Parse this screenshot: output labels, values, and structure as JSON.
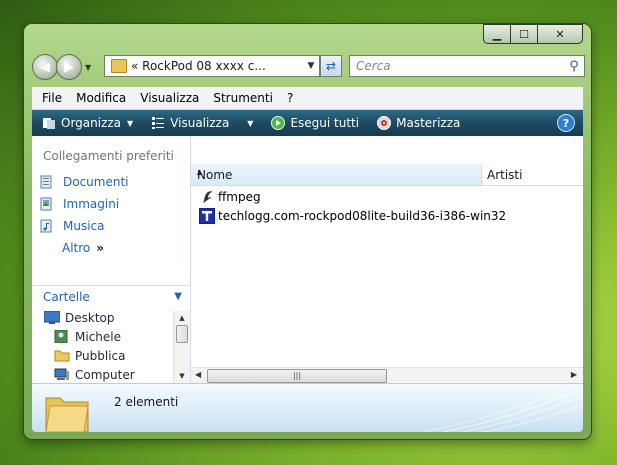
{
  "window": {
    "address": {
      "crumb": "« RockPod 08 xxxx c..."
    },
    "search": {
      "placeholder": "Cerca"
    }
  },
  "menubar": [
    "File",
    "Modifica",
    "Visualizza",
    "Strumenti",
    "?"
  ],
  "toolbar": {
    "organize": "Organizza",
    "view": "Visualizza",
    "run_all": "Esegui tutti",
    "burn": "Masterizza"
  },
  "sidebar": {
    "favorites_header": "Collegamenti preferiti",
    "favorites": [
      "Documenti",
      "Immagini",
      "Musica"
    ],
    "more": "Altro",
    "folders_header": "Cartelle",
    "tree": [
      "Desktop",
      "Michele",
      "Pubblica",
      "Computer"
    ]
  },
  "list": {
    "columns": {
      "name": "Nome",
      "artists": "Artisti"
    },
    "files": [
      "ffmpeg",
      "techlogg.com-rockpod08lite-build36-i386-win32"
    ]
  },
  "details": {
    "count": "2 elementi"
  },
  "colors": {
    "toolbar": "#1d4a63",
    "link": "#1f63b8"
  }
}
